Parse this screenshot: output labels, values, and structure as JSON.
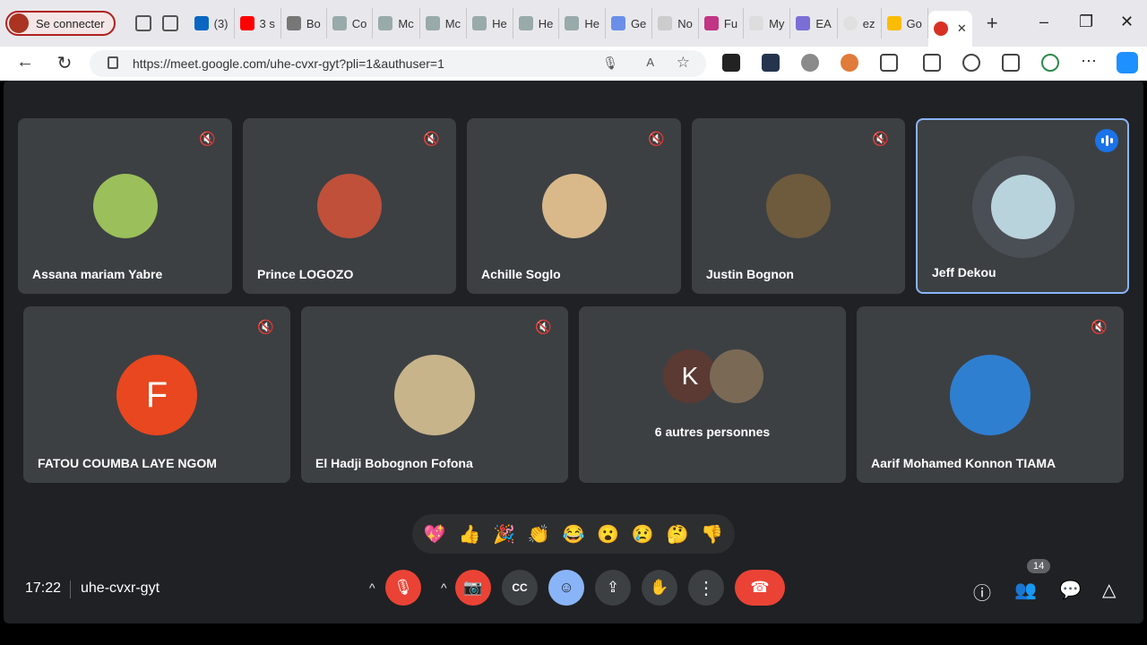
{
  "browser": {
    "profile_label": "Se connecter",
    "tabs": [
      "(3)",
      "3 s",
      "Bo",
      "Co",
      "Mc",
      "Mc",
      "He",
      "He",
      "He",
      "Ge",
      "No",
      "Fu",
      "My",
      "EA",
      "ez",
      "Go"
    ],
    "url": "https://meet.google.com/uhe-cvxr-gyt?pli=1&authuser=1",
    "new_tab": "+",
    "min": "–",
    "restore": "❐",
    "close": "✕"
  },
  "participants": [
    {
      "name": "Assana mariam Yabre",
      "muted": true
    },
    {
      "name": "Prince LOGOZO",
      "muted": true
    },
    {
      "name": "Achille Soglo",
      "muted": true
    },
    {
      "name": "Justin Bognon",
      "muted": true
    },
    {
      "name": "Jeff Dekou",
      "speaking": true
    },
    {
      "name": "FATOU COUMBA LAYE NGOM",
      "muted": true,
      "initial": "F"
    },
    {
      "name": "El Hadji Bobognon Fofona",
      "muted": true
    },
    {
      "name": "6 autres personnes",
      "initial": "K"
    },
    {
      "name": "Aarif Mohamed Konnon TIAMA",
      "muted": true
    }
  ],
  "reactions": [
    "💖",
    "👍",
    "🎉",
    "👏",
    "😂",
    "😮",
    "😢",
    "🤔",
    "👎"
  ],
  "bottom": {
    "time": "17:22",
    "meeting_code": "uhe-cvxr-gyt",
    "people_count": "14"
  },
  "colors": {
    "accent": "#8ab4f8",
    "danger": "#ea4335",
    "tile": "#3c4043",
    "bg": "#202124"
  }
}
